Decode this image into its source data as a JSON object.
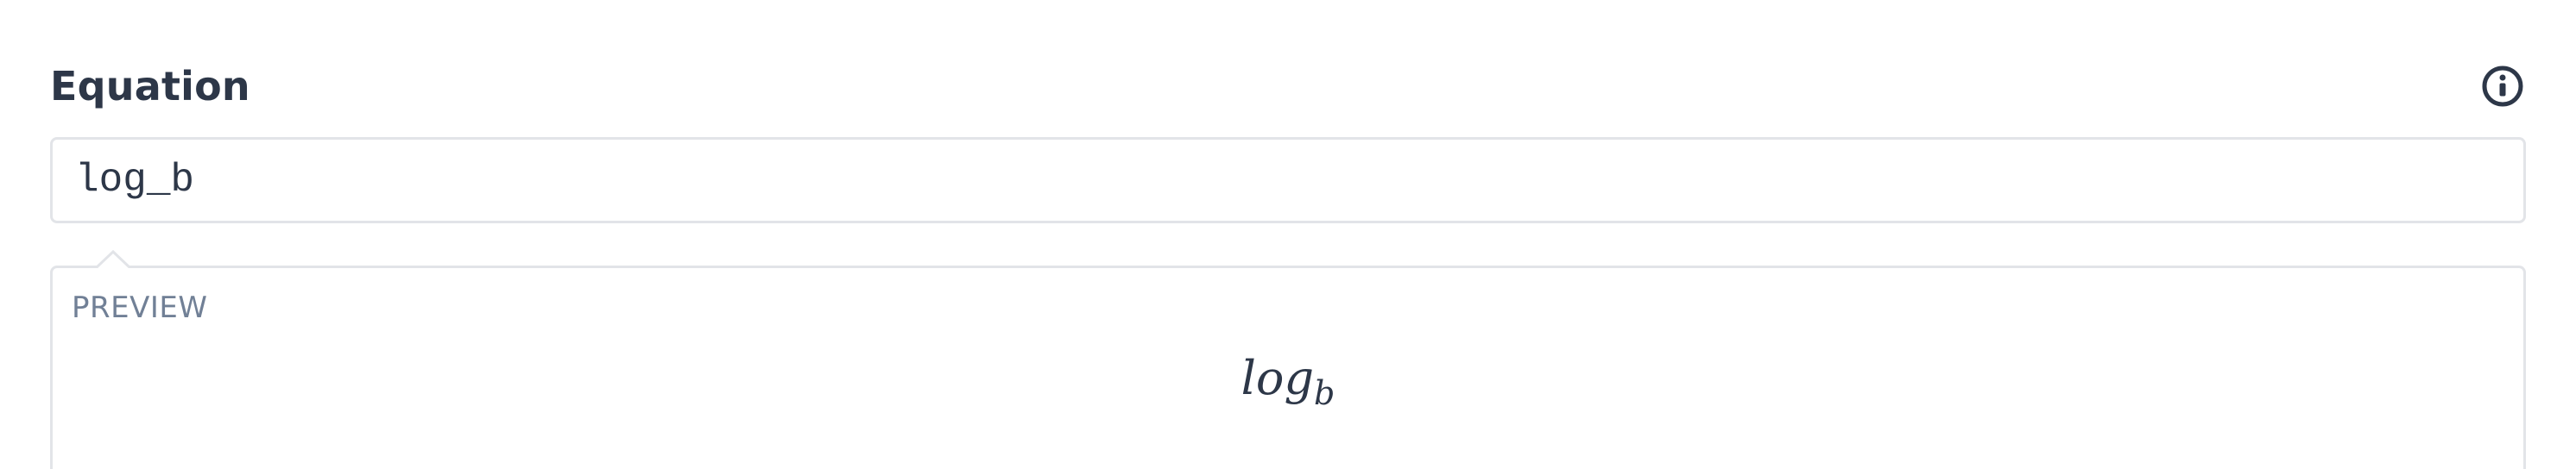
{
  "header": {
    "title": "Equation",
    "info_icon": "info-icon"
  },
  "equation_input": {
    "value": "log_b"
  },
  "preview": {
    "label": "PREVIEW",
    "rendered_base": "log",
    "rendered_subscript": "b"
  },
  "colors": {
    "text": "#2d3748",
    "muted": "#718096",
    "border": "#e2e4e8"
  }
}
